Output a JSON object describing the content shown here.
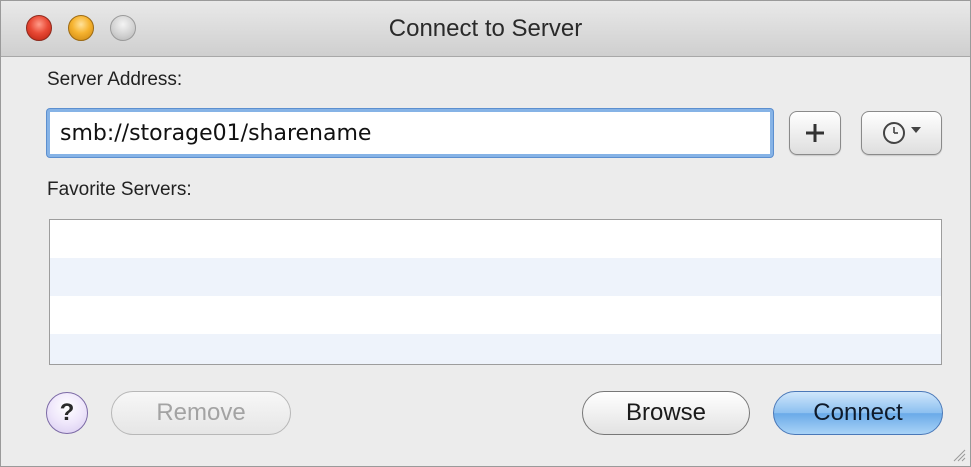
{
  "window": {
    "title": "Connect to Server"
  },
  "server_address": {
    "label": "Server Address:",
    "value": "smb://storage01/sharename"
  },
  "buttons": {
    "add_icon": "plus-icon",
    "recent_icon": "clock-icon",
    "remove_label": "Remove",
    "browse_label": "Browse",
    "connect_label": "Connect",
    "help_label": "?"
  },
  "favorites": {
    "label": "Favorite Servers:",
    "items": []
  },
  "colors": {
    "accent": "#6aaae8",
    "focus_ring": "#86b3e6",
    "close": "#e94a36",
    "minimize": "#f6b32f"
  }
}
